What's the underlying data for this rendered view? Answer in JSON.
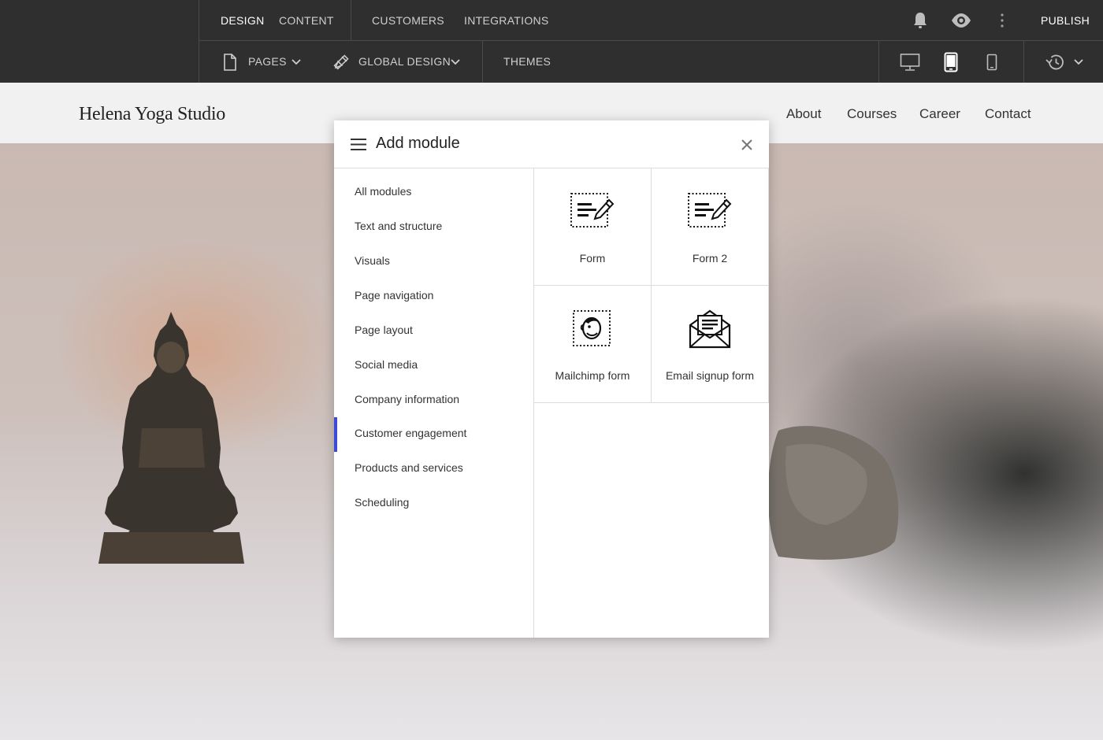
{
  "topbar": {
    "row1_tabs": [
      {
        "label": "DESIGN",
        "active": true
      },
      {
        "label": "CONTENT",
        "active": false
      },
      {
        "label": "CUSTOMERS",
        "active": false
      },
      {
        "label": "INTEGRATIONS",
        "active": false
      }
    ],
    "publish_label": "PUBLISH",
    "row2": {
      "pages_label": "PAGES",
      "global_design_label": "GLOBAL DESIGN",
      "themes_label": "THEMES"
    },
    "device_selected": "tablet",
    "icons": [
      "bell-icon",
      "eye-icon",
      "more-vertical-icon",
      "page-icon",
      "pencil-ruler-icon",
      "chevron-down-icon",
      "desktop-icon",
      "tablet-icon",
      "mobile-icon",
      "history-icon"
    ]
  },
  "site": {
    "title": "Helena Yoga Studio",
    "nav": [
      "About",
      "Courses",
      "Career",
      "Contact"
    ]
  },
  "modal": {
    "title": "Add module",
    "categories": [
      "All modules",
      "Text and structure",
      "Visuals",
      "Page navigation",
      "Page layout",
      "Social media",
      "Company information",
      "Customer engagement",
      "Products and services",
      "Scheduling"
    ],
    "selected_category": "Customer engagement",
    "modules": [
      {
        "label": "Form",
        "icon": "form-icon"
      },
      {
        "label": "Form 2",
        "icon": "form-icon"
      },
      {
        "label": "Mailchimp form",
        "icon": "mailchimp-icon"
      },
      {
        "label": "Email signup form",
        "icon": "envelope-icon"
      }
    ]
  },
  "colors": {
    "topbar_bg": "#2f2f2f",
    "selection_accent": "#3b4bd8",
    "site_header_bg": "#f1f1f1"
  }
}
